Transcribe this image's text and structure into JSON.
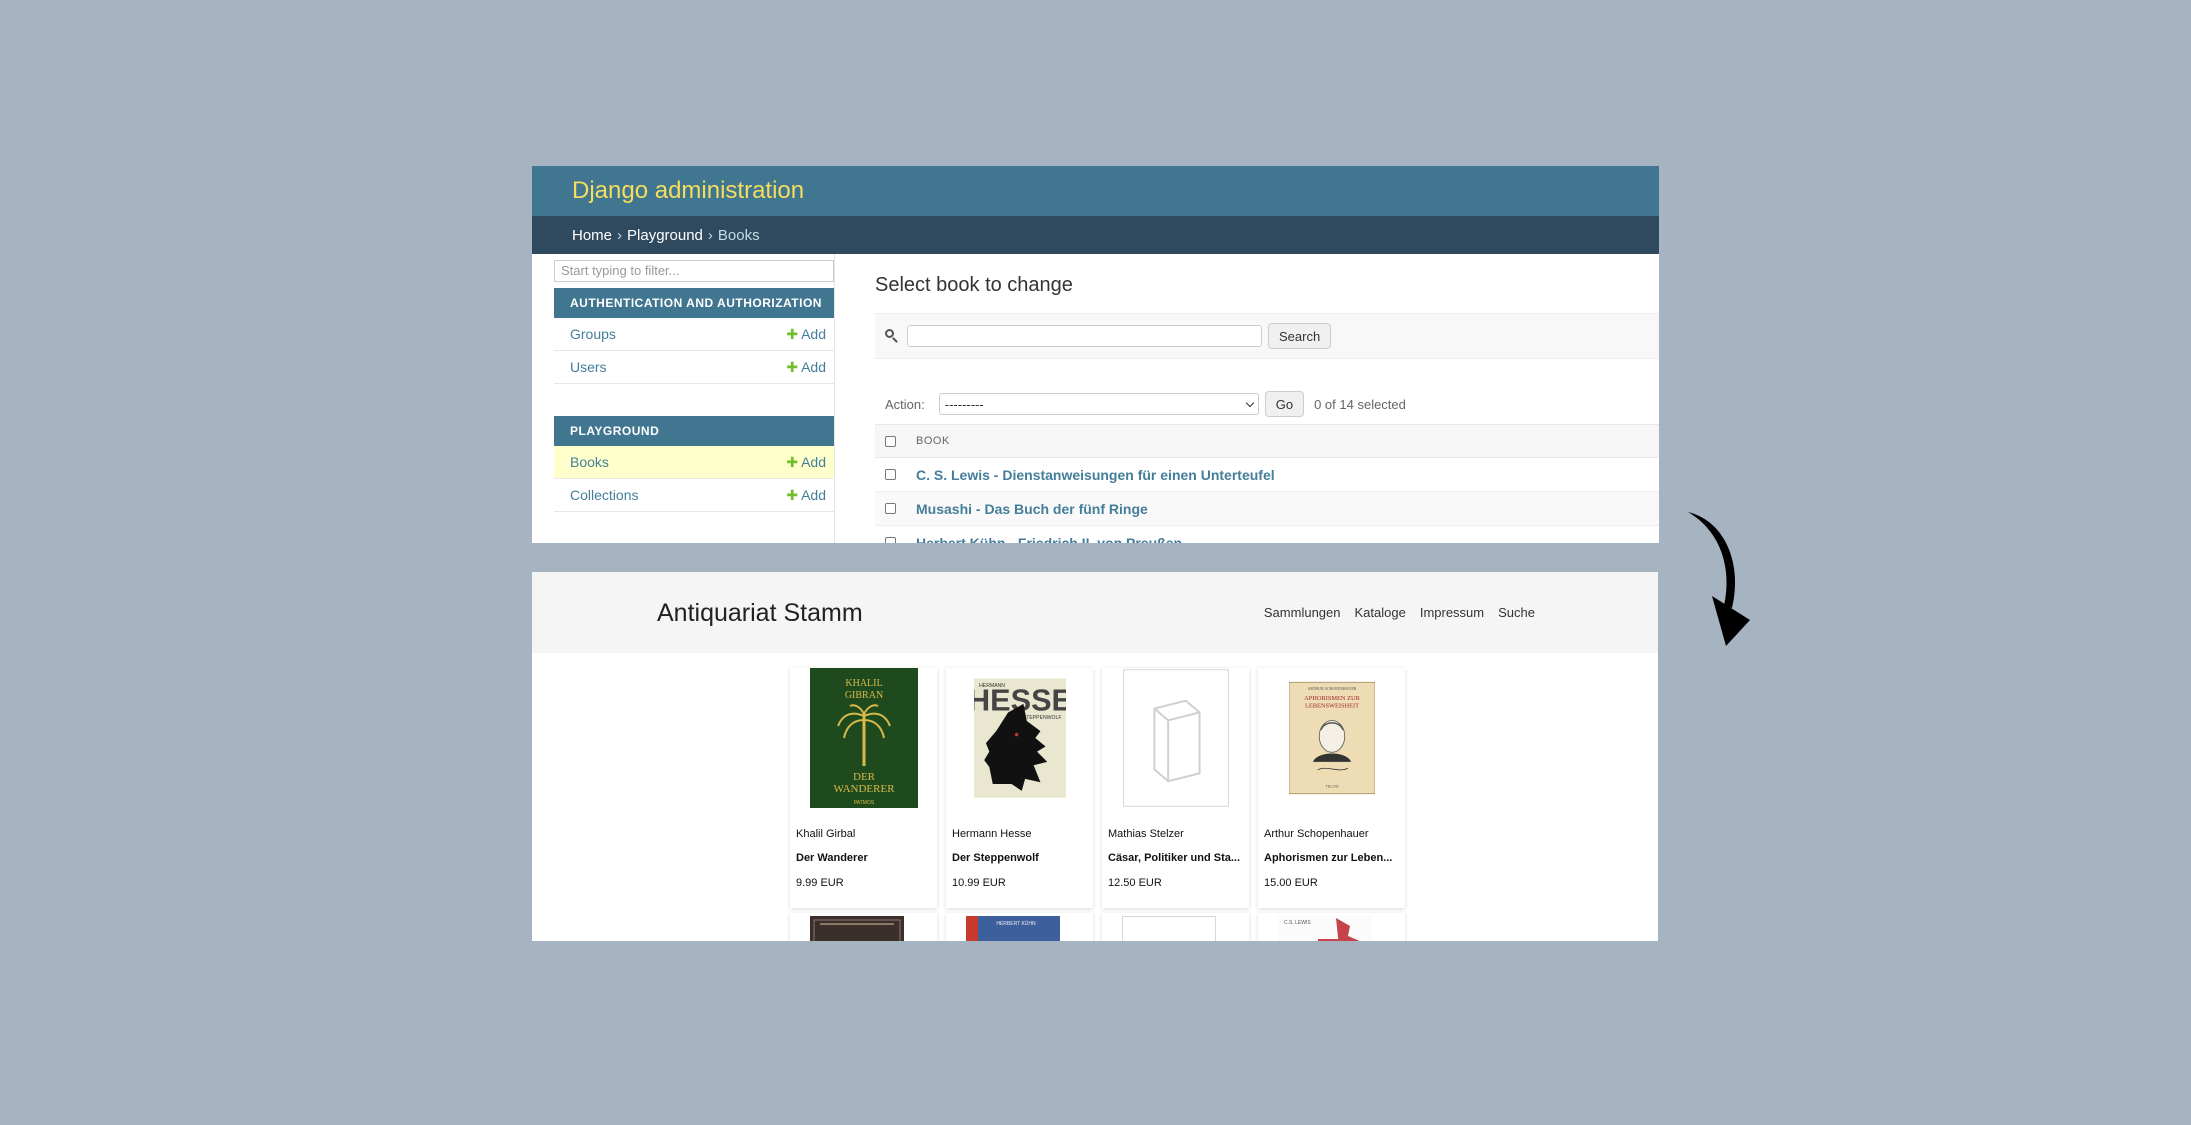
{
  "admin": {
    "site_title": "Django administration",
    "breadcrumb": {
      "home": "Home",
      "app": "Playground",
      "current": "Books",
      "sep": "›"
    },
    "filter_placeholder": "Start typing to filter...",
    "modules": [
      {
        "caption": "AUTHENTICATION AND AUTHORIZATION",
        "models": [
          {
            "name": "Groups",
            "add": "Add"
          },
          {
            "name": "Users",
            "add": "Add"
          }
        ]
      },
      {
        "caption": "PLAYGROUND",
        "models": [
          {
            "name": "Books",
            "add": "Add"
          },
          {
            "name": "Collections",
            "add": "Add"
          }
        ]
      }
    ],
    "page_title": "Select book to change",
    "search_button": "Search",
    "action_label": "Action:",
    "action_value": "---------",
    "go_button": "Go",
    "selected_count": "0 of 14 selected",
    "column_header": "BOOK",
    "rows": [
      "C. S. Lewis - Dienstanweisungen für einen Unterteufel",
      "Musashi - Das Buch der fünf Ringe",
      "Herbert Kühn - Friedrich II. von Preußen"
    ]
  },
  "shop": {
    "brand": "Antiquariat Stamm",
    "nav": [
      "Sammlungen",
      "Kataloge",
      "Impressum",
      "Suche"
    ],
    "books": [
      {
        "author": "Khalil Girbal",
        "title": "Der Wanderer",
        "price": "9.99 EUR",
        "cover_text": [
          "KHALIL",
          "GIBRAN",
          "DER",
          "WANDERER",
          "PATMOS"
        ]
      },
      {
        "author": "Hermann Hesse",
        "title": "Der Steppenwolf",
        "price": "10.99 EUR",
        "cover_text": [
          "HERMANN",
          "HESSE",
          "STEPPENWOLF"
        ]
      },
      {
        "author": "Mathias Stelzer",
        "title": "Cäsar, Politiker und Sta...",
        "price": "12.50 EUR"
      },
      {
        "author": "Arthur Schopenhauer",
        "title": "Aphorismen zur Leben...",
        "price": "15.00 EUR",
        "cover_text": [
          "ARTHUR SCHOPENHAUER",
          "APHORISMEN ZUR",
          "LEBENSWEISHEIT",
          "TELOS"
        ]
      }
    ],
    "row2_cover_text": [
      "HERBERT KÜHN",
      "C.S. LEWIS"
    ]
  },
  "colors": {
    "background": "#a6b3c1",
    "admin_header": "#417690",
    "admin_title": "#f5dd5d",
    "breadcrumb_bar": "#2f4a5e",
    "link": "#447e9b",
    "add_plus": "#70bf2b",
    "active_row": "#ffffcc"
  }
}
